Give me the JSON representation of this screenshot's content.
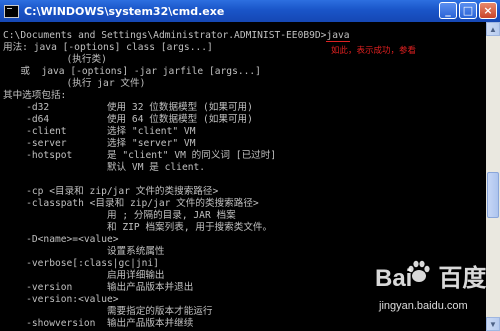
{
  "window": {
    "title": "C:\\WINDOWS\\system32\\cmd.exe",
    "minimize_label": "_",
    "maximize_label": "□",
    "close_label": "×"
  },
  "console": {
    "prompt": "C:\\Documents and Settings\\Administrator.ADMINIST-EE0B9D>",
    "command": "java",
    "lines": [
      "用法: java [-options] class [args...]",
      "           (执行类)",
      "   或  java [-options] -jar jarfile [args...]",
      "           (执行 jar 文件)",
      "其中选项包括:",
      "    -d32          使用 32 位数据模型 (如果可用)",
      "    -d64          使用 64 位数据模型 (如果可用)",
      "    -client       选择 \"client\" VM",
      "    -server       选择 \"server\" VM",
      "    -hotspot      是 \"client\" VM 的同义词 [已过时]",
      "                  默认 VM 是 client.",
      "",
      "    -cp <目录和 zip/jar 文件的类搜索路径>",
      "    -classpath <目录和 zip/jar 文件的类搜索路径>",
      "                  用 ; 分隔的目录, JAR 档案",
      "                  和 ZIP 档案列表, 用于搜索类文件。",
      "    -D<name>=<value>",
      "                  设置系统属性",
      "    -verbose[:class|gc|jni]",
      "                  启用详细输出",
      "    -version      输出产品版本并退出",
      "    -version:<value>",
      "                  需要指定的版本才能运行",
      "    -showversion  输出产品版本并继续"
    ]
  },
  "annotation": "如此，表示成功，参看",
  "watermark": {
    "logo_left": "Bai",
    "logo_right": "百度",
    "url": "jingyan.baidu.com"
  },
  "scrollbar": {
    "up_icon": "▲",
    "down_icon": "▼"
  }
}
